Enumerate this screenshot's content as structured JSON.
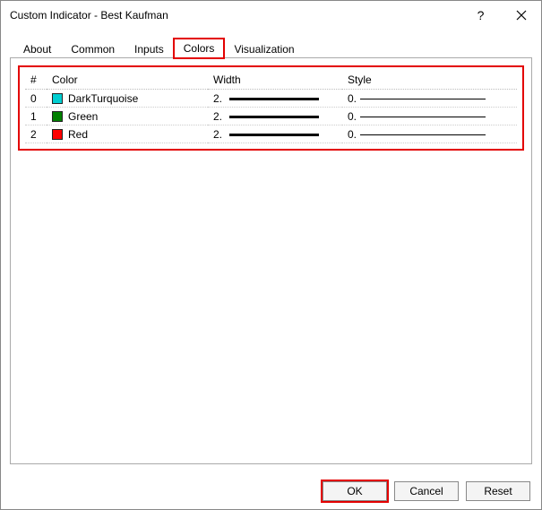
{
  "window": {
    "title": "Custom Indicator - Best Kaufman"
  },
  "tabs": {
    "items": [
      {
        "label": "About"
      },
      {
        "label": "Common"
      },
      {
        "label": "Inputs"
      },
      {
        "label": "Colors",
        "active": true,
        "highlight": true
      },
      {
        "label": "Visualization"
      }
    ]
  },
  "table": {
    "headers": {
      "index": "#",
      "color": "Color",
      "width": "Width",
      "style": "Style"
    },
    "rows": [
      {
        "index": "0",
        "color_name": "DarkTurquoise",
        "color_hex": "#00CED1",
        "width": "2.",
        "style": "0."
      },
      {
        "index": "1",
        "color_name": "Green",
        "color_hex": "#008000",
        "width": "2.",
        "style": "0."
      },
      {
        "index": "2",
        "color_name": "Red",
        "color_hex": "#FF0000",
        "width": "2.",
        "style": "0."
      }
    ]
  },
  "buttons": {
    "ok": "OK",
    "cancel": "Cancel",
    "reset": "Reset"
  }
}
